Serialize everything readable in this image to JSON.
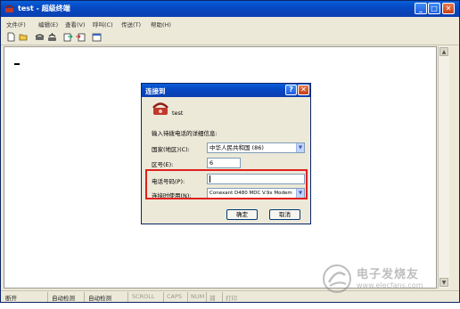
{
  "window": {
    "title": "test - 超级终端",
    "controls": {
      "minimize": "_",
      "maximize": "□",
      "close": "✕"
    }
  },
  "menubar": {
    "items": [
      "文件(F)",
      "编辑(E)",
      "查看(V)",
      "呼叫(C)",
      "传送(T)",
      "帮助(H)"
    ]
  },
  "toolbar": {
    "icons": [
      "new-icon",
      "open-icon",
      "connect-icon",
      "disconnect-icon",
      "send-icon",
      "receive-icon",
      "properties-icon"
    ]
  },
  "terminal": {
    "cursor": "_"
  },
  "dialog": {
    "title": "连接到",
    "help": "?",
    "close": "✕",
    "connection_name": "test",
    "instruction": "输入待拨电话的详细信息:",
    "country_label": "国家(地区)(C):",
    "country_value": "中华人民共和国 (86)",
    "area_label": "区号(E):",
    "area_value": "6",
    "phone_label": "电话号码(P):",
    "phone_value": "",
    "connect_label": "连接时使用(N):",
    "connect_value": "Conexant D480 MDC V.9x Modem",
    "ok": "确定",
    "cancel": "取消"
  },
  "statusbar": {
    "cells": [
      {
        "text": "断开",
        "dim": false
      },
      {
        "text": "自动检测",
        "dim": false
      },
      {
        "text": "自动检测",
        "dim": false
      },
      {
        "text": "SCROLL",
        "dim": true
      },
      {
        "text": "CAPS",
        "dim": true
      },
      {
        "text": "NUM",
        "dim": true
      },
      {
        "text": "捕",
        "dim": true
      },
      {
        "text": "打印",
        "dim": true
      }
    ]
  },
  "watermark": {
    "text": "电子发烧友",
    "url": "www.elecfans.com"
  },
  "colors": {
    "titlebar": "#0649c3",
    "highlight": "#e0201e",
    "close_button": "#c5401a"
  }
}
